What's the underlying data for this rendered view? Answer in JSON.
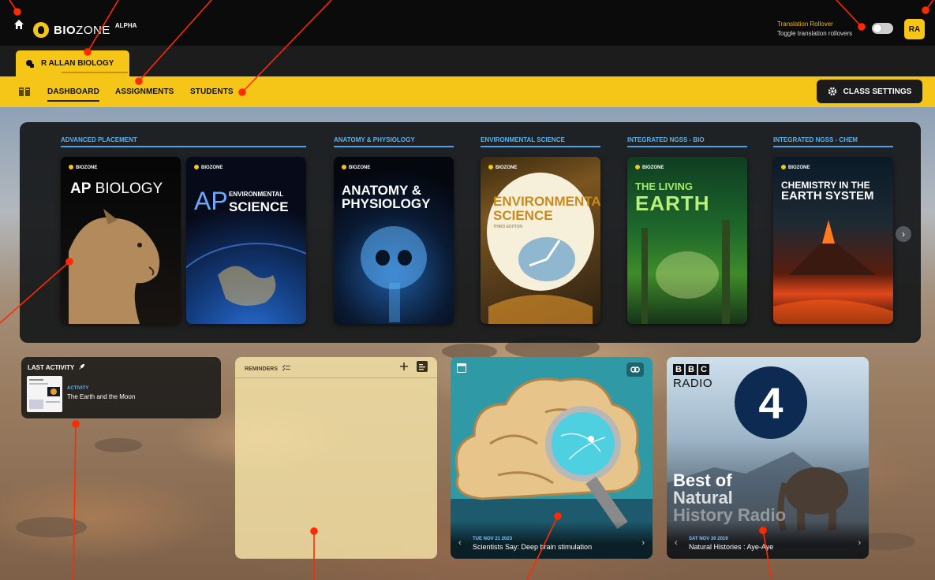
{
  "topbar": {
    "brand_bold": "BIO",
    "brand_thin": "ZONE",
    "brand_tag": "ALPHA",
    "rollover_title": "Translation Rollover",
    "rollover_desc": "Toggle translation rollovers",
    "avatar_initials": "RA"
  },
  "class_tab": {
    "label": "R ALLAN BIOLOGY"
  },
  "nav": {
    "items": [
      {
        "label": "DASHBOARD",
        "active": true
      },
      {
        "label": "ASSIGNMENTS",
        "active": false
      },
      {
        "label": "STUDENTS",
        "active": false
      }
    ],
    "class_settings": "CLASS SETTINGS"
  },
  "books": {
    "categories": [
      "ADVANCED PLACEMENT",
      "ANATOMY & PHYSIOLOGY",
      "ENVIRONMENTAL SCIENCE",
      "INTEGRATED NGSS - BIO",
      "INTEGRATED NGSS - CHEM"
    ],
    "brand": "BIOZONE",
    "covers": {
      "ap_bio": {
        "bold": "AP",
        "rest": " BIOLOGY"
      },
      "ap_env": {
        "ap": "AP",
        "line1": "ENVIRONMENTAL",
        "line2": "SCIENCE"
      },
      "anatomy": {
        "line1": "ANATOMY &",
        "line2": "PHYSIOLOGY"
      },
      "env_sci": {
        "line1": "ENVIRONMENTAL",
        "line2": "SCIENCE",
        "edition": "THIRD EDITION"
      },
      "earth": {
        "line1": "THE LIVING",
        "line2": "EARTH"
      },
      "chem": {
        "line1": "CHEMISTRY IN THE",
        "line2": "EARTH SYSTEM"
      }
    }
  },
  "last_activity": {
    "title": "LAST ACTIVITY",
    "type": "ACTIVITY",
    "name": "The Earth and the Moon"
  },
  "reminders": {
    "title": "REMINDERS"
  },
  "podcasts": [
    {
      "date": "TUE NOV 21 2023",
      "title": "Scientists Say: Deep brain stimulation"
    },
    {
      "date": "SAT NOV 30 2019",
      "title": "Natural Histories : Aye-Aye"
    }
  ],
  "radio_card": {
    "bbc": [
      "B",
      "B",
      "C"
    ],
    "radio_word": "RADIO",
    "number": "4",
    "best_of": [
      "Best of",
      "Natural",
      "History Radio"
    ]
  },
  "colors": {
    "accent_yellow": "#f5c518",
    "category_blue": "#4aa3e6",
    "annotation_red": "#ff2a00"
  }
}
